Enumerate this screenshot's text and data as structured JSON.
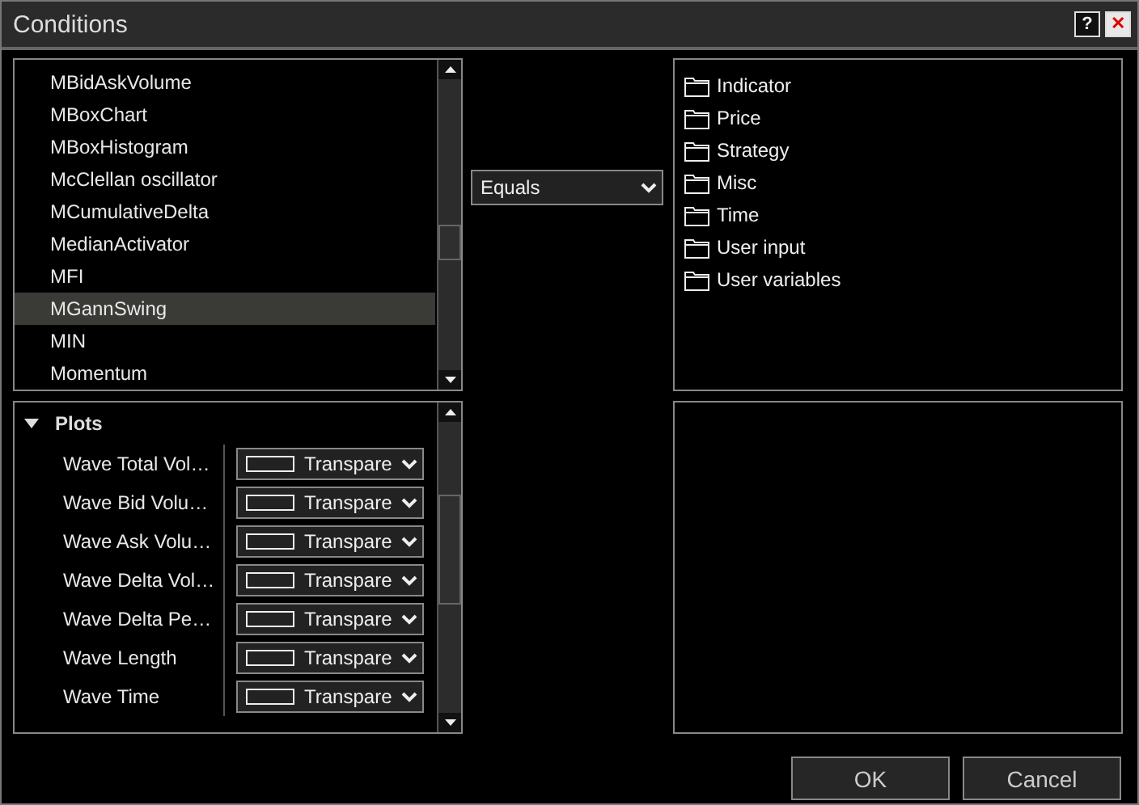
{
  "window": {
    "title": "Conditions",
    "help": "?",
    "close": "✕"
  },
  "indicator_list": {
    "items": [
      {
        "label": "MBidAskVolume",
        "selected": false
      },
      {
        "label": "MBoxChart",
        "selected": false
      },
      {
        "label": "MBoxHistogram",
        "selected": false
      },
      {
        "label": "McClellan oscillator",
        "selected": false
      },
      {
        "label": "MCumulativeDelta",
        "selected": false
      },
      {
        "label": "MedianActivator",
        "selected": false
      },
      {
        "label": "MFI",
        "selected": false
      },
      {
        "label": "MGannSwing",
        "selected": true
      },
      {
        "label": "MIN",
        "selected": false
      },
      {
        "label": "Momentum",
        "selected": false
      }
    ]
  },
  "operator": {
    "value": "Equals"
  },
  "tree": {
    "items": [
      {
        "label": "Indicator"
      },
      {
        "label": "Price"
      },
      {
        "label": "Strategy"
      },
      {
        "label": "Misc"
      },
      {
        "label": "Time"
      },
      {
        "label": "User input"
      },
      {
        "label": "User variables"
      }
    ]
  },
  "properties": {
    "category": {
      "label": "Plots",
      "expanded": true
    },
    "rows": [
      {
        "name": "Wave Total Vol…",
        "value": "Transpare"
      },
      {
        "name": "Wave Bid Volu…",
        "value": "Transpare"
      },
      {
        "name": "Wave Ask Volu…",
        "value": "Transpare"
      },
      {
        "name": "Wave Delta Vol…",
        "value": "Transpare"
      },
      {
        "name": "Wave Delta Pe…",
        "value": "Transpare"
      },
      {
        "name": "Wave Length",
        "value": "Transpare"
      },
      {
        "name": "Wave Time",
        "value": "Transpare"
      }
    ]
  },
  "buttons": [
    "OK",
    "Cancel"
  ]
}
